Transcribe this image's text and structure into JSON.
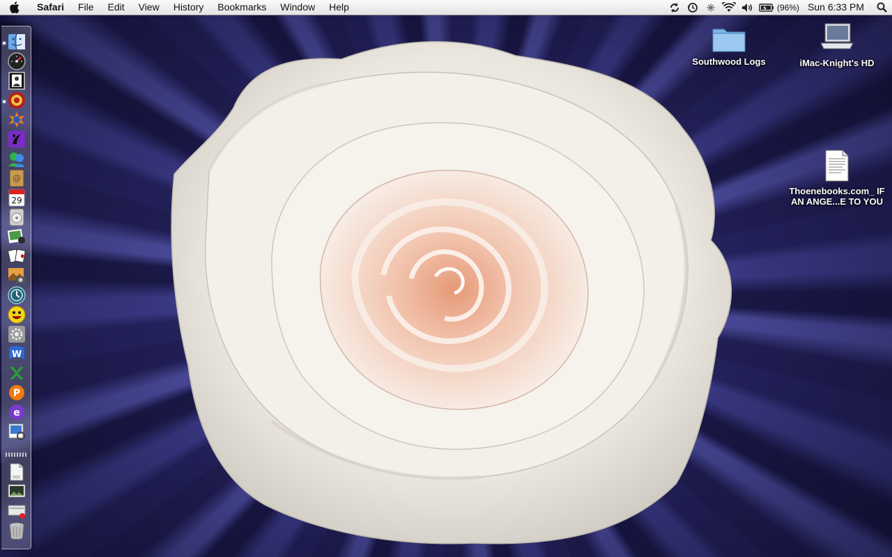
{
  "menubar": {
    "app_name": "Safari",
    "menus": [
      "File",
      "Edit",
      "View",
      "History",
      "Bookmarks",
      "Window",
      "Help"
    ],
    "status_icons": [
      "sync-icon",
      "time-machine-icon",
      "bluetooth-icon",
      "wifi-icon",
      "volume-icon",
      "battery-icon"
    ],
    "battery_percent": "(96%)",
    "clock": "Sun 6:33 PM"
  },
  "desktop": {
    "icons": [
      {
        "label": "Southwood Logs",
        "icon": "folder-icon"
      },
      {
        "label": "iMac-Knight's HD",
        "icon": "hard-drive-icon"
      },
      {
        "label": "Thoenebooks.com_ IF AN ANGE...E TO YOU",
        "icon": "document-icon"
      }
    ]
  },
  "dock": {
    "items": [
      {
        "icon": "finder-icon",
        "running": true
      },
      {
        "icon": "dashboard-icon",
        "running": false
      },
      {
        "icon": "photo-booth-icon",
        "running": false
      },
      {
        "icon": "safari-icon",
        "running": true
      },
      {
        "icon": "firefox-icon",
        "running": false
      },
      {
        "icon": "front-row-icon",
        "running": false
      },
      {
        "icon": "messenger-icon",
        "running": false
      },
      {
        "icon": "address-book-icon",
        "running": false
      },
      {
        "icon": "ical-icon",
        "running": false,
        "badge": "29"
      },
      {
        "icon": "dvd-player-icon",
        "running": false
      },
      {
        "icon": "iphoto-icon",
        "running": false
      },
      {
        "icon": "solitaire-icon",
        "running": false
      },
      {
        "icon": "image-capture-icon",
        "running": false
      },
      {
        "icon": "time-machine-app-icon",
        "running": false
      },
      {
        "icon": "yahoo-messenger-icon",
        "running": false
      },
      {
        "icon": "system-preferences-icon",
        "running": false
      },
      {
        "icon": "word-icon",
        "running": false
      },
      {
        "icon": "excel-icon",
        "running": false
      },
      {
        "icon": "powerpoint-icon",
        "running": false
      },
      {
        "icon": "entourage-icon",
        "running": false
      },
      {
        "icon": "preview-icon",
        "running": false
      },
      {
        "icon": "document-stack-icon",
        "running": false
      },
      {
        "icon": "pictures-stack-icon",
        "running": false
      },
      {
        "icon": "downloads-stack-icon",
        "running": false
      },
      {
        "icon": "trash-icon",
        "running": false
      }
    ]
  },
  "colors": {
    "wallpaper_dark": "#1e1c48",
    "wallpaper_light": "#4a4a9b",
    "rose_petal": "#f4f1ea",
    "rose_center": "#f0b8a0"
  }
}
